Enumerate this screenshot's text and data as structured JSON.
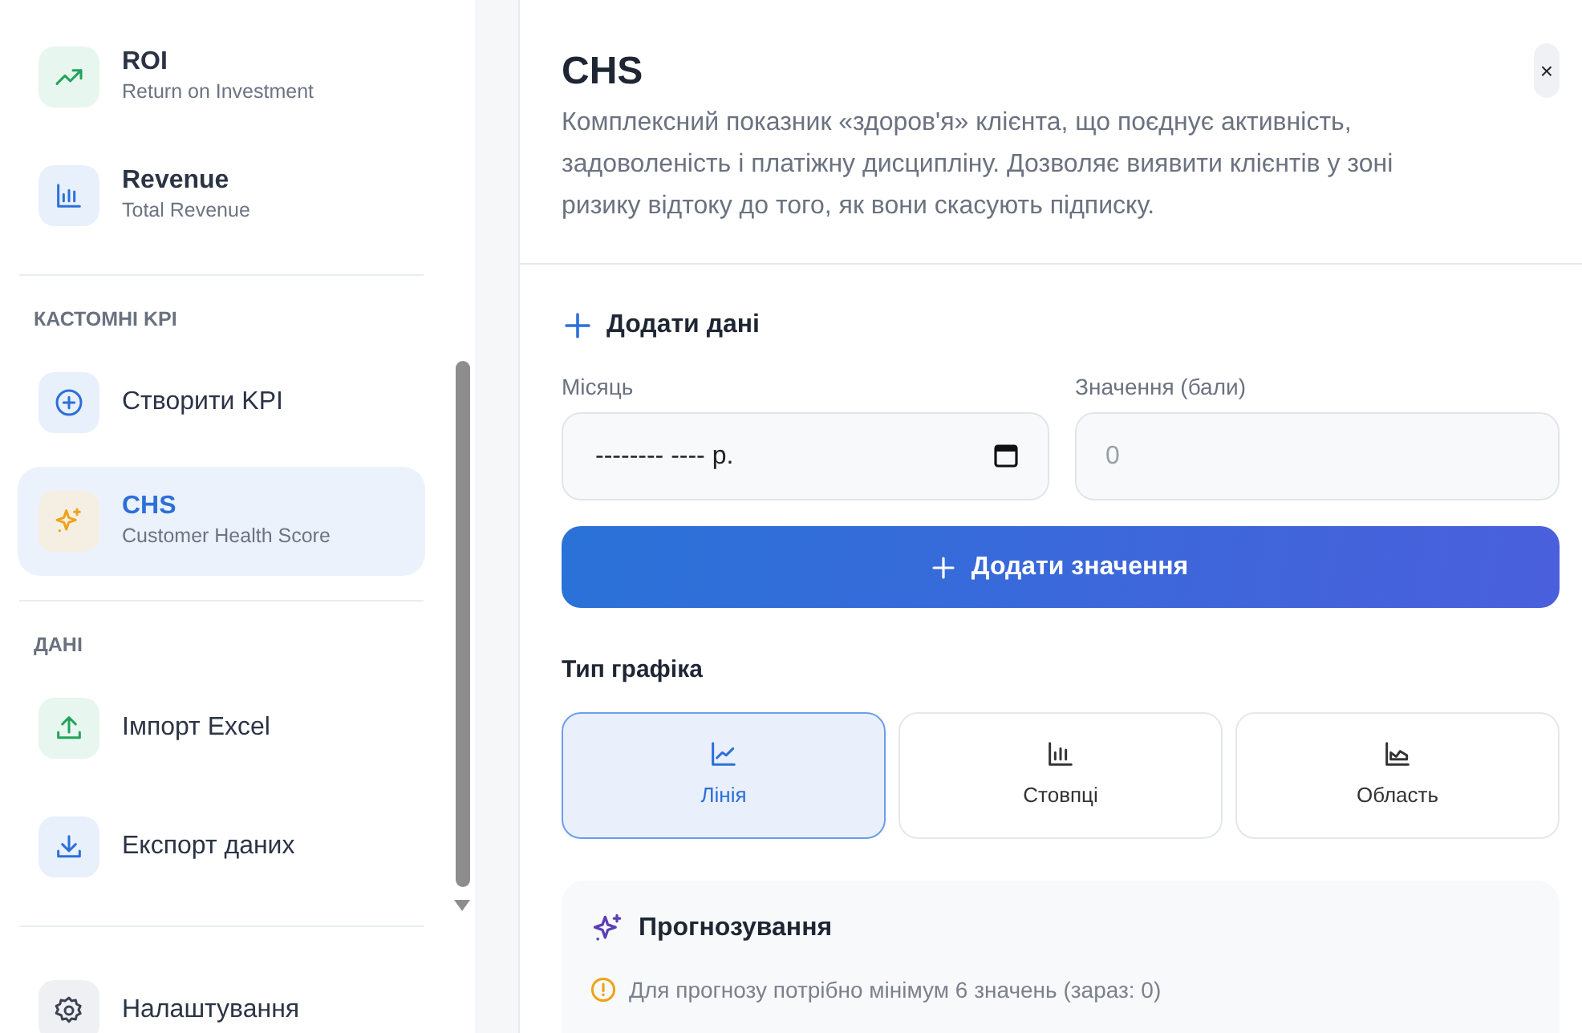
{
  "sidebar": {
    "sections": [
      {
        "items": [
          {
            "title": "ROI",
            "subtitle": "Return on Investment",
            "selected": false
          },
          {
            "title": "Revenue",
            "subtitle": "Total Revenue",
            "selected": false
          }
        ]
      },
      {
        "heading": "КАСТОМНІ KPI",
        "items": [
          {
            "title": "Створити KPI",
            "selected": false
          },
          {
            "title": "CHS",
            "subtitle": "Customer Health Score",
            "selected": true
          }
        ]
      },
      {
        "heading": "ДАНІ",
        "items": [
          {
            "title": "Імпорт Excel",
            "selected": false
          },
          {
            "title": "Експорт даних",
            "selected": false
          }
        ]
      },
      {
        "items": [
          {
            "title": "Налаштування",
            "selected": false
          }
        ]
      }
    ]
  },
  "panel": {
    "title": "CHS",
    "close": "×",
    "description": "Комплексний показник «здоров'я» клієнта, що поєднує активність, задоволеність і платіжну дисципліну. Дозволяє виявити клієнтів у зоні ризику відтоку до того, як вони скасують підписку.",
    "add_data": {
      "heading": "Додати дані",
      "fields": [
        {
          "kind": "month",
          "label": "Місяць",
          "placeholder": "-------- ---- р."
        },
        {
          "kind": "number",
          "label": "Значення (бали)",
          "placeholder": "0"
        }
      ],
      "button": "Додати значення"
    },
    "chart_type": {
      "heading": "Тип графіка",
      "options": [
        {
          "label": "Лінія",
          "selected": true
        },
        {
          "label": "Стовпці",
          "selected": false
        },
        {
          "label": "Область",
          "selected": false
        }
      ]
    },
    "forecast": {
      "heading": "Прогнозування",
      "notice": "Для прогнозу потрібно мінімум 6 значень (зараз: 0)"
    }
  }
}
